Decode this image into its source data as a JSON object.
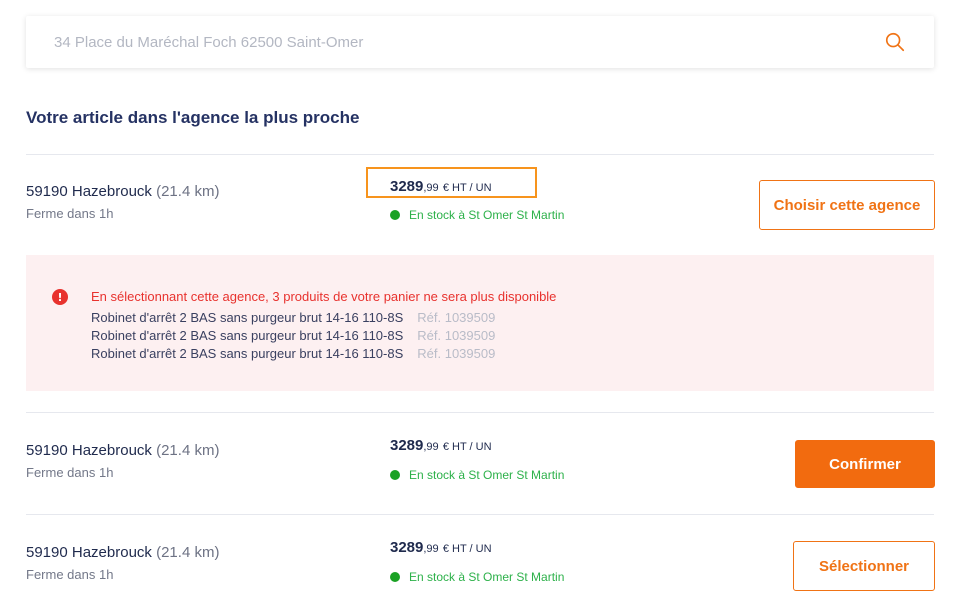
{
  "search": {
    "placeholder": "34 Place du Maréchal Foch 62500 Saint-Omer"
  },
  "section_title": "Votre article dans l'agence la plus proche",
  "agencies": [
    {
      "name": "59190 Hazebrouck",
      "distance": "(21.4 km)",
      "hours": "Ferme dans 1h",
      "price_main": "3289",
      "price_cents": ",99",
      "price_unit": "€ HT / UN",
      "stock": "En stock à St Omer St Martin",
      "button_label": "Choisir cette agence"
    },
    {
      "name": "59190 Hazebrouck",
      "distance": "(21.4 km)",
      "hours": "Ferme dans 1h",
      "price_main": "3289",
      "price_cents": ",99",
      "price_unit": "€ HT / UN",
      "stock": "En stock à St Omer St Martin",
      "button_label": "Confirmer"
    },
    {
      "name": "59190 Hazebrouck",
      "distance": "(21.4 km)",
      "hours": "Ferme dans 1h",
      "price_main": "3289",
      "price_cents": ",99",
      "price_unit": "€ HT / UN",
      "stock": "En stock à St Omer St Martin",
      "button_label": "Sélectionner"
    }
  ],
  "warning": {
    "icon": "!",
    "title": "En sélectionnant cette agence, 3 produits de votre panier ne sera plus disponible",
    "items": [
      {
        "name": "Robinet d'arrêt 2 BAS sans purgeur brut 14-16 110-8S",
        "ref": "Réf. 1039509"
      },
      {
        "name": "Robinet d'arrêt 2 BAS sans purgeur brut 14-16 110-8S",
        "ref": "Réf. 1039509"
      },
      {
        "name": "Robinet d'arrêt 2 BAS sans purgeur brut 14-16 110-8S",
        "ref": "Réf. 1039509"
      }
    ]
  },
  "colors": {
    "accent": "#f26b0f",
    "highlight": "#f7941d",
    "stock_green": "#1aa123",
    "error_red": "#e8322e",
    "warning_bg": "#fdf0f1"
  }
}
